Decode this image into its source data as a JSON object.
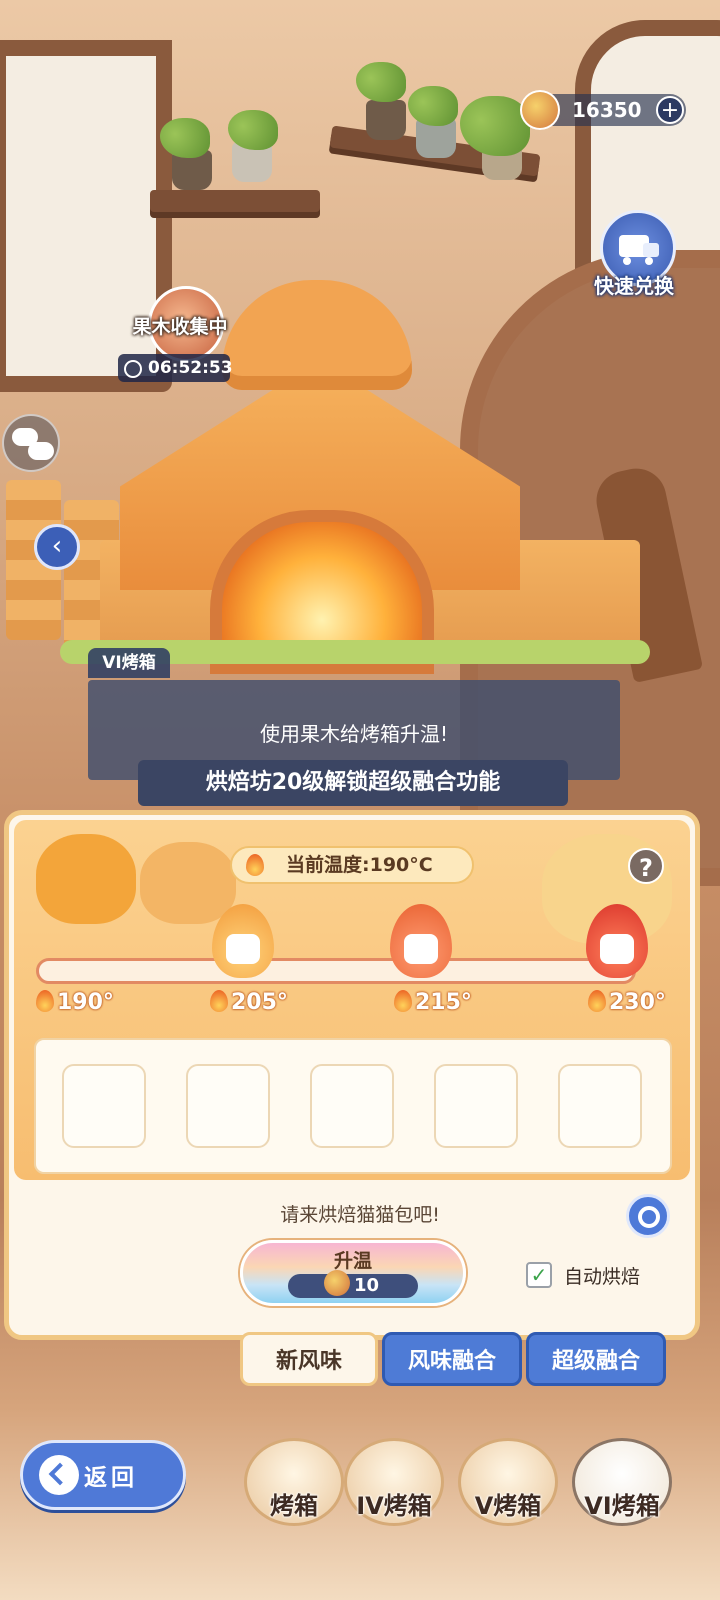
{
  "top": {
    "currency_value": "16350",
    "add_label": "+",
    "quick_exchange_label": "快速兑换"
  },
  "wood": {
    "title": "果木收集中",
    "timer": "06:52:53"
  },
  "dialog": {
    "speaker": "VI烤箱",
    "text": "使用果木给烤箱升温!",
    "banner": "烘焙坊20级解锁超级融合功能"
  },
  "panel": {
    "current_temp": "当前温度:190°C",
    "help_label": "?",
    "ticks": [
      "190°",
      "205°",
      "215°",
      "230°"
    ],
    "prompt": "请来烘焙猫猫包吧!",
    "heat_button": {
      "label": "升温",
      "cost": "10"
    },
    "auto_bake_label": "自动烘焙",
    "auto_bake_checked": "✓"
  },
  "tabs": [
    "新风味",
    "风味融合",
    "超级融合"
  ],
  "bottom": {
    "back_label": "返回",
    "ovens": [
      "烤箱",
      "IV烤箱",
      "V烤箱",
      "VI烤箱"
    ]
  },
  "colors": {
    "accent_blue": "#4e7bd6",
    "panel_orange": "#f7bd70",
    "flame": "#e9551d"
  }
}
